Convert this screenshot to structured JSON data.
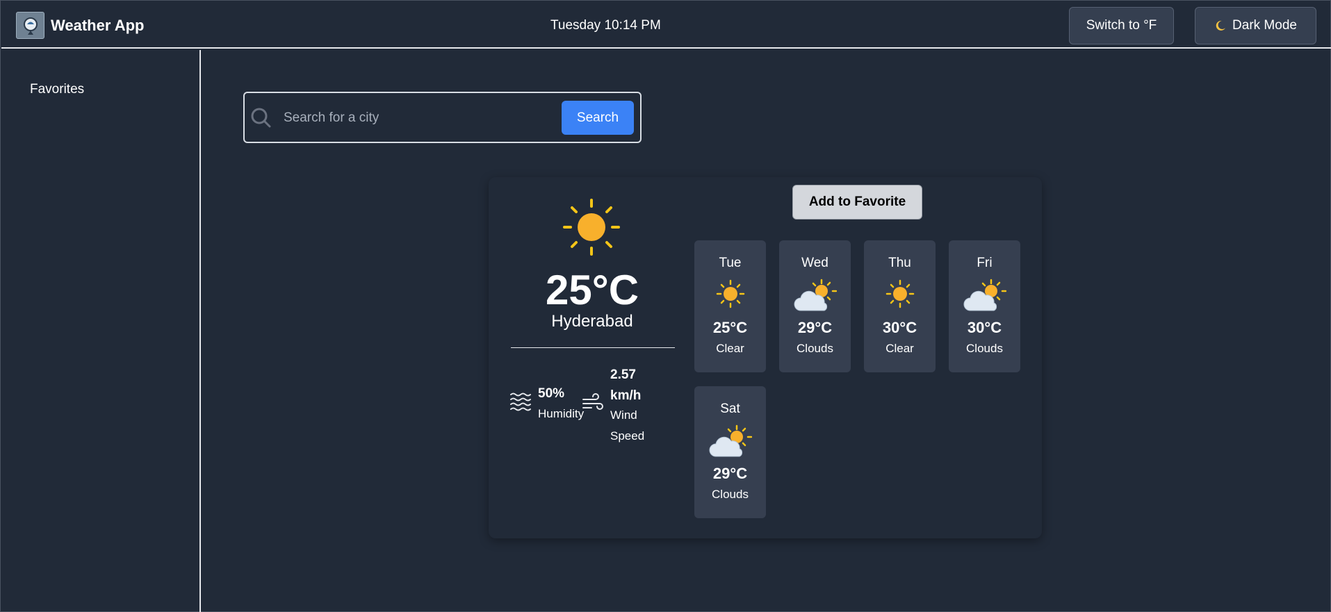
{
  "header": {
    "app_title": "Weather App",
    "datetime": "Tuesday 10:14 PM",
    "unit_toggle_label": "Switch to °F",
    "dark_mode_label": "Dark Mode"
  },
  "sidebar": {
    "favorites_title": "Favorites"
  },
  "search": {
    "placeholder": "Search for a city",
    "value": "",
    "button_label": "Search"
  },
  "current": {
    "icon": "sun-icon",
    "temperature": "25°C",
    "city": "Hyderabad",
    "humidity_value": "50%",
    "humidity_label": "Humidity",
    "wind_value": "2.57 km/h",
    "wind_label": "Wind Speed"
  },
  "add_favorite_label": "Add to Favorite",
  "forecast": [
    {
      "day": "Tue",
      "temp": "25°C",
      "desc": "Clear",
      "icon": "sun-icon"
    },
    {
      "day": "Wed",
      "temp": "29°C",
      "desc": "Clouds",
      "icon": "partly-cloudy-icon"
    },
    {
      "day": "Thu",
      "temp": "30°C",
      "desc": "Clear",
      "icon": "sun-icon"
    },
    {
      "day": "Fri",
      "temp": "30°C",
      "desc": "Clouds",
      "icon": "partly-cloudy-icon"
    },
    {
      "day": "Sat",
      "temp": "29°C",
      "desc": "Clouds",
      "icon": "partly-cloudy-icon"
    }
  ],
  "colors": {
    "background": "#212a38",
    "accent": "#3b82f6",
    "sun": "#f8b02c",
    "sun_rays": "#f5c518",
    "tile": "#363f50"
  }
}
